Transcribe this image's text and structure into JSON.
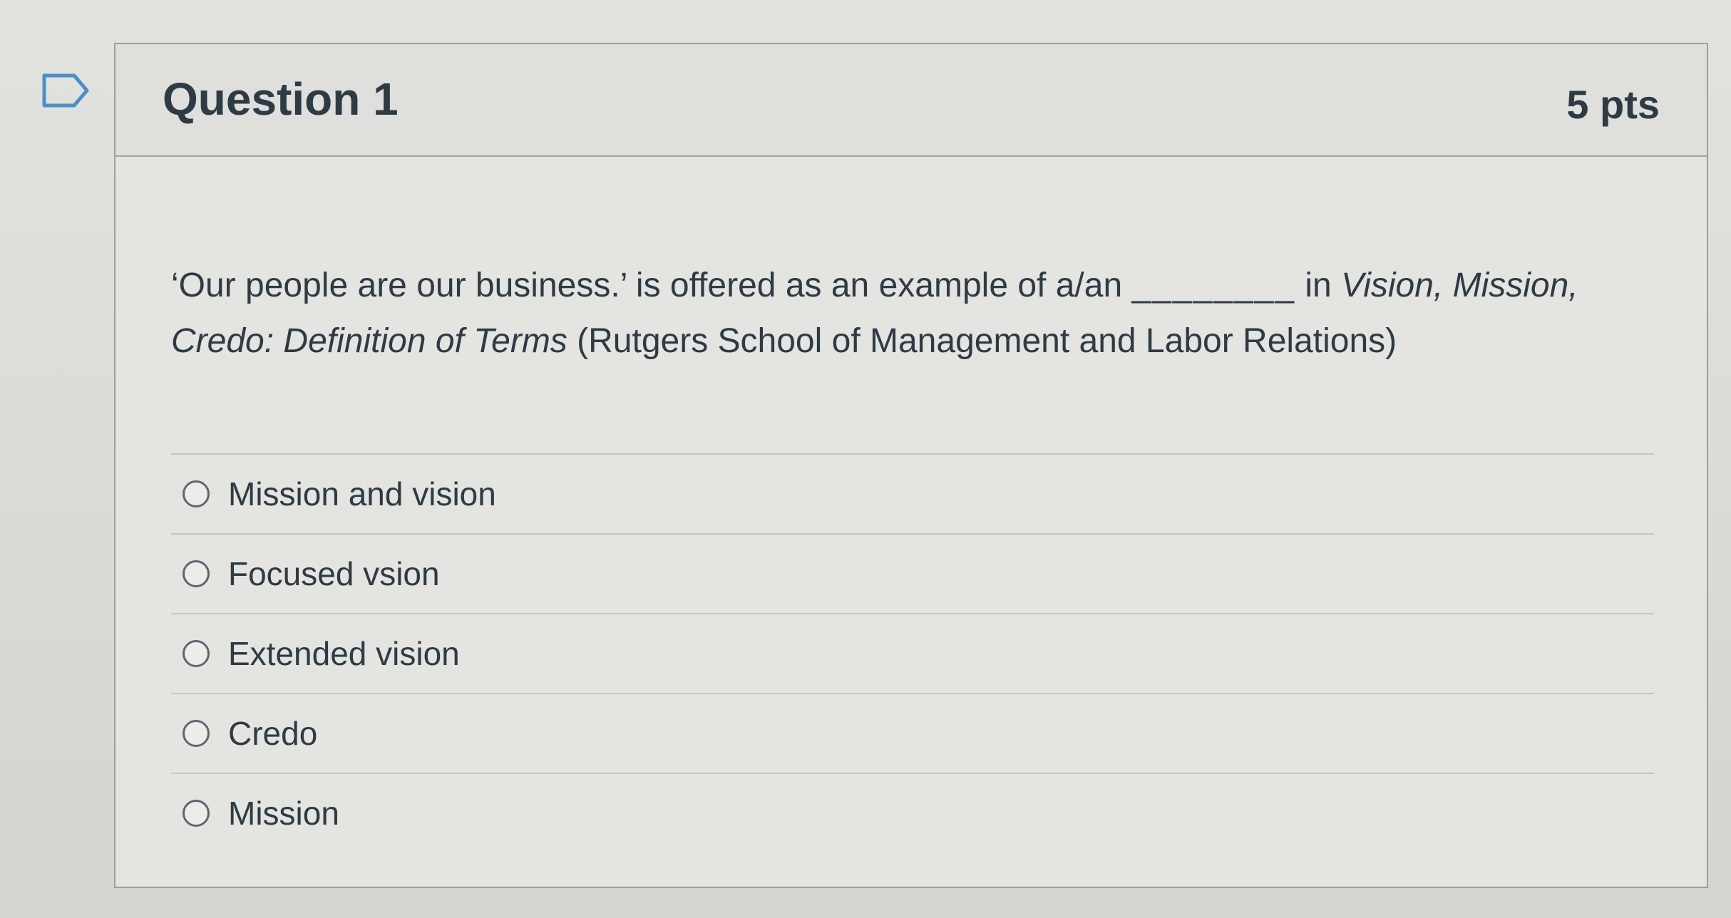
{
  "question": {
    "title": "Question 1",
    "points": "5 pts",
    "text_part1": "‘Our people are our business.’ is offered as an example of a/an ",
    "blank": "________",
    "text_part2": " in ",
    "source_italic1": "Vision, Mission, Credo: Definition of Terms",
    "text_part3": " (Rutgers School of Management and Labor Relations)"
  },
  "answers": [
    {
      "label": "Mission and vision",
      "selected": false
    },
    {
      "label": "Focused vsion",
      "selected": false
    },
    {
      "label": "Extended vision",
      "selected": false
    },
    {
      "label": "Credo",
      "selected": false
    },
    {
      "label": "Mission",
      "selected": false
    }
  ],
  "icons": {
    "flag": "flag-question-icon",
    "radio": "radio-unchecked-icon"
  },
  "colors": {
    "text": "#2d3b45",
    "border": "#9e9e9a",
    "flag": "#4a90c8"
  }
}
